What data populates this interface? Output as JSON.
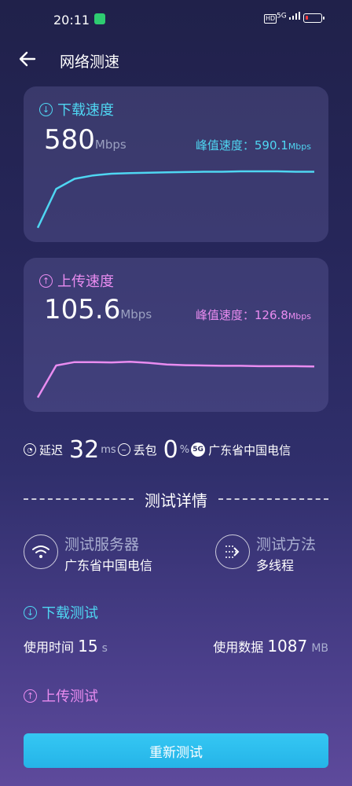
{
  "status_bar": {
    "time": "20:11",
    "signal_text": "5G",
    "hd_badge": "HD"
  },
  "header": {
    "title": "网络测速"
  },
  "download": {
    "label": "下载速度",
    "value": "580",
    "unit": "Mbps",
    "peak_label": "峰值速度：",
    "peak_value": "590.1",
    "peak_unit": "Mbps",
    "color": "#4fd6f2"
  },
  "upload": {
    "label": "上传速度",
    "value": "105.6",
    "unit": "Mbps",
    "peak_label": "峰值速度：",
    "peak_value": "126.8",
    "peak_unit": "Mbps",
    "color": "#e98cf0"
  },
  "stats": {
    "latency_label": "延迟",
    "latency_value": "32",
    "latency_unit": "ms",
    "loss_label": "丢包",
    "loss_value": "0",
    "loss_unit": "%",
    "network_badge": "5G",
    "isp": "广东省中国电信"
  },
  "details": {
    "section_title": "测试详情",
    "server_label": "测试服务器",
    "server_value": "广东省中国电信",
    "method_label": "测试方法",
    "method_value": "多线程",
    "download_test_label": "下载测试",
    "time_label": "使用时间",
    "time_value": "15",
    "time_unit": "s",
    "data_label": "使用数据",
    "data_value": "1087",
    "data_unit": "MB",
    "upload_test_label": "上传测试"
  },
  "retest_button": "重新测试",
  "icons": {
    "back": "arrow-left-icon",
    "download": "download-circle-icon",
    "upload": "upload-circle-icon",
    "latency": "latency-icon",
    "loss": "packet-loss-icon",
    "wifi": "wifi-icon",
    "multithread": "multithread-icon"
  },
  "chart_data": [
    {
      "type": "line",
      "series": [
        {
          "values": [
            5,
            120,
            150,
            160,
            165,
            167,
            168,
            169,
            170,
            171,
            171,
            172,
            172,
            172,
            171,
            171
          ]
        }
      ]
    },
    {
      "type": "line",
      "series": [
        {
          "values": [
            5,
            100,
            110,
            110,
            109,
            111,
            108,
            103,
            101,
            100,
            99,
            99,
            98,
            98,
            98,
            97
          ]
        }
      ]
    }
  ]
}
